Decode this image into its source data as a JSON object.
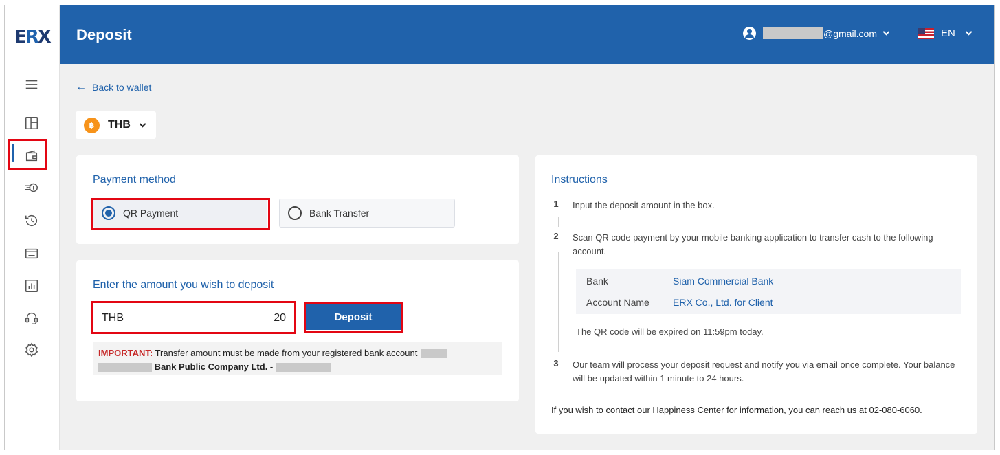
{
  "app": {
    "logo": "ERX"
  },
  "header": {
    "title": "Deposit",
    "email_suffix": "@gmail.com",
    "language": "EN"
  },
  "nav": {
    "back_label": "Back to wallet",
    "icons": [
      "menu-icon",
      "dashboard-icon",
      "wallet-icon",
      "transfer-icon",
      "history-icon",
      "bank-card-icon",
      "chart-icon",
      "support-icon",
      "settings-icon"
    ],
    "active": "wallet-icon"
  },
  "currency": {
    "code": "THB",
    "coin_symbol": "฿"
  },
  "payment_method": {
    "title": "Payment method",
    "options": [
      {
        "label": "QR Payment",
        "selected": true
      },
      {
        "label": "Bank Transfer",
        "selected": false
      }
    ]
  },
  "amount": {
    "title": "Enter the amount you wish to deposit",
    "currency": "THB",
    "value": "20",
    "button_label": "Deposit"
  },
  "important": {
    "prefix": "IMPORTANT:",
    "text": "Transfer amount must be made from your registered bank account",
    "bank_name": "Bank Public Company Ltd. -"
  },
  "instructions": {
    "title": "Instructions",
    "steps": [
      {
        "num": "1",
        "text": "Input the deposit amount in the box."
      },
      {
        "num": "2",
        "text": "Scan QR code payment by your mobile banking application to transfer cash to the following account."
      },
      {
        "num": "3",
        "text": "Our team will process your deposit request and notify you via email once complete. Your balance will be updated within 1 minute to 24 hours."
      }
    ],
    "bank_label": "Bank",
    "bank_value": "Siam Commercial Bank",
    "account_label": "Account Name",
    "account_value": "ERX Co., Ltd. for Client",
    "expiry": "The QR code will be expired on 11:59pm today.",
    "contact": "If you wish to contact our Happiness Center for information, you can reach us at 02-080-6060."
  },
  "colors": {
    "brand": "#2062ab",
    "highlight": "#e30613",
    "coin": "#f7931a",
    "important": "#c62828"
  }
}
